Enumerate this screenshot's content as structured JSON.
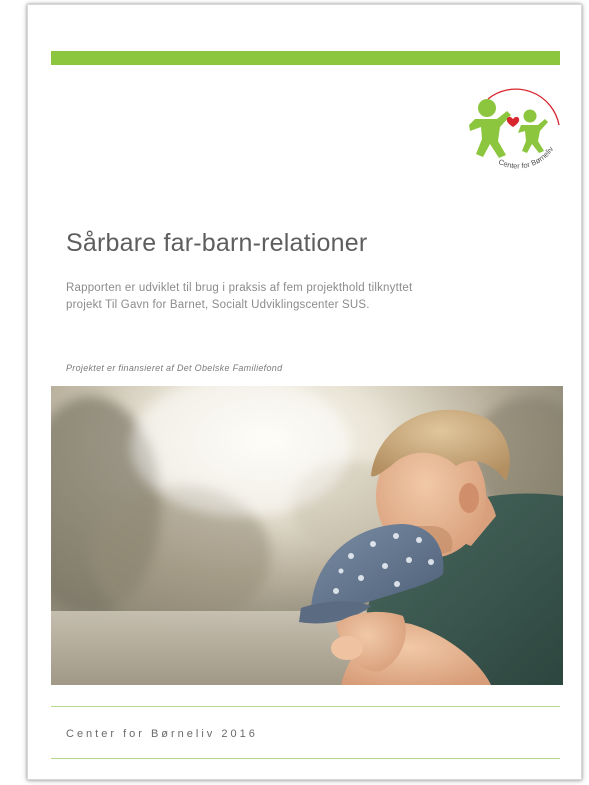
{
  "document": {
    "title": "Sårbare far-barn-relationer",
    "subtitle": "Rapporten er udviklet til brug i praksis af fem projekthold tilknyttet projekt Til Gavn for Barnet, Socialt Udviklingscenter SUS.",
    "funding_note": "Projektet er finansieret af Det Obelske Familiefond",
    "footer": "Center for Børneliv 2016"
  },
  "logo": {
    "text": "Center for Børneliv",
    "icon": "two-children-heart-logo"
  },
  "photo": {
    "icon": "father-holding-child-photo"
  },
  "colors": {
    "accent_green": "#8cc63f",
    "rule_green": "#b5d98a",
    "heart_red": "#d8262f",
    "title_gray": "#5e5e5e"
  }
}
